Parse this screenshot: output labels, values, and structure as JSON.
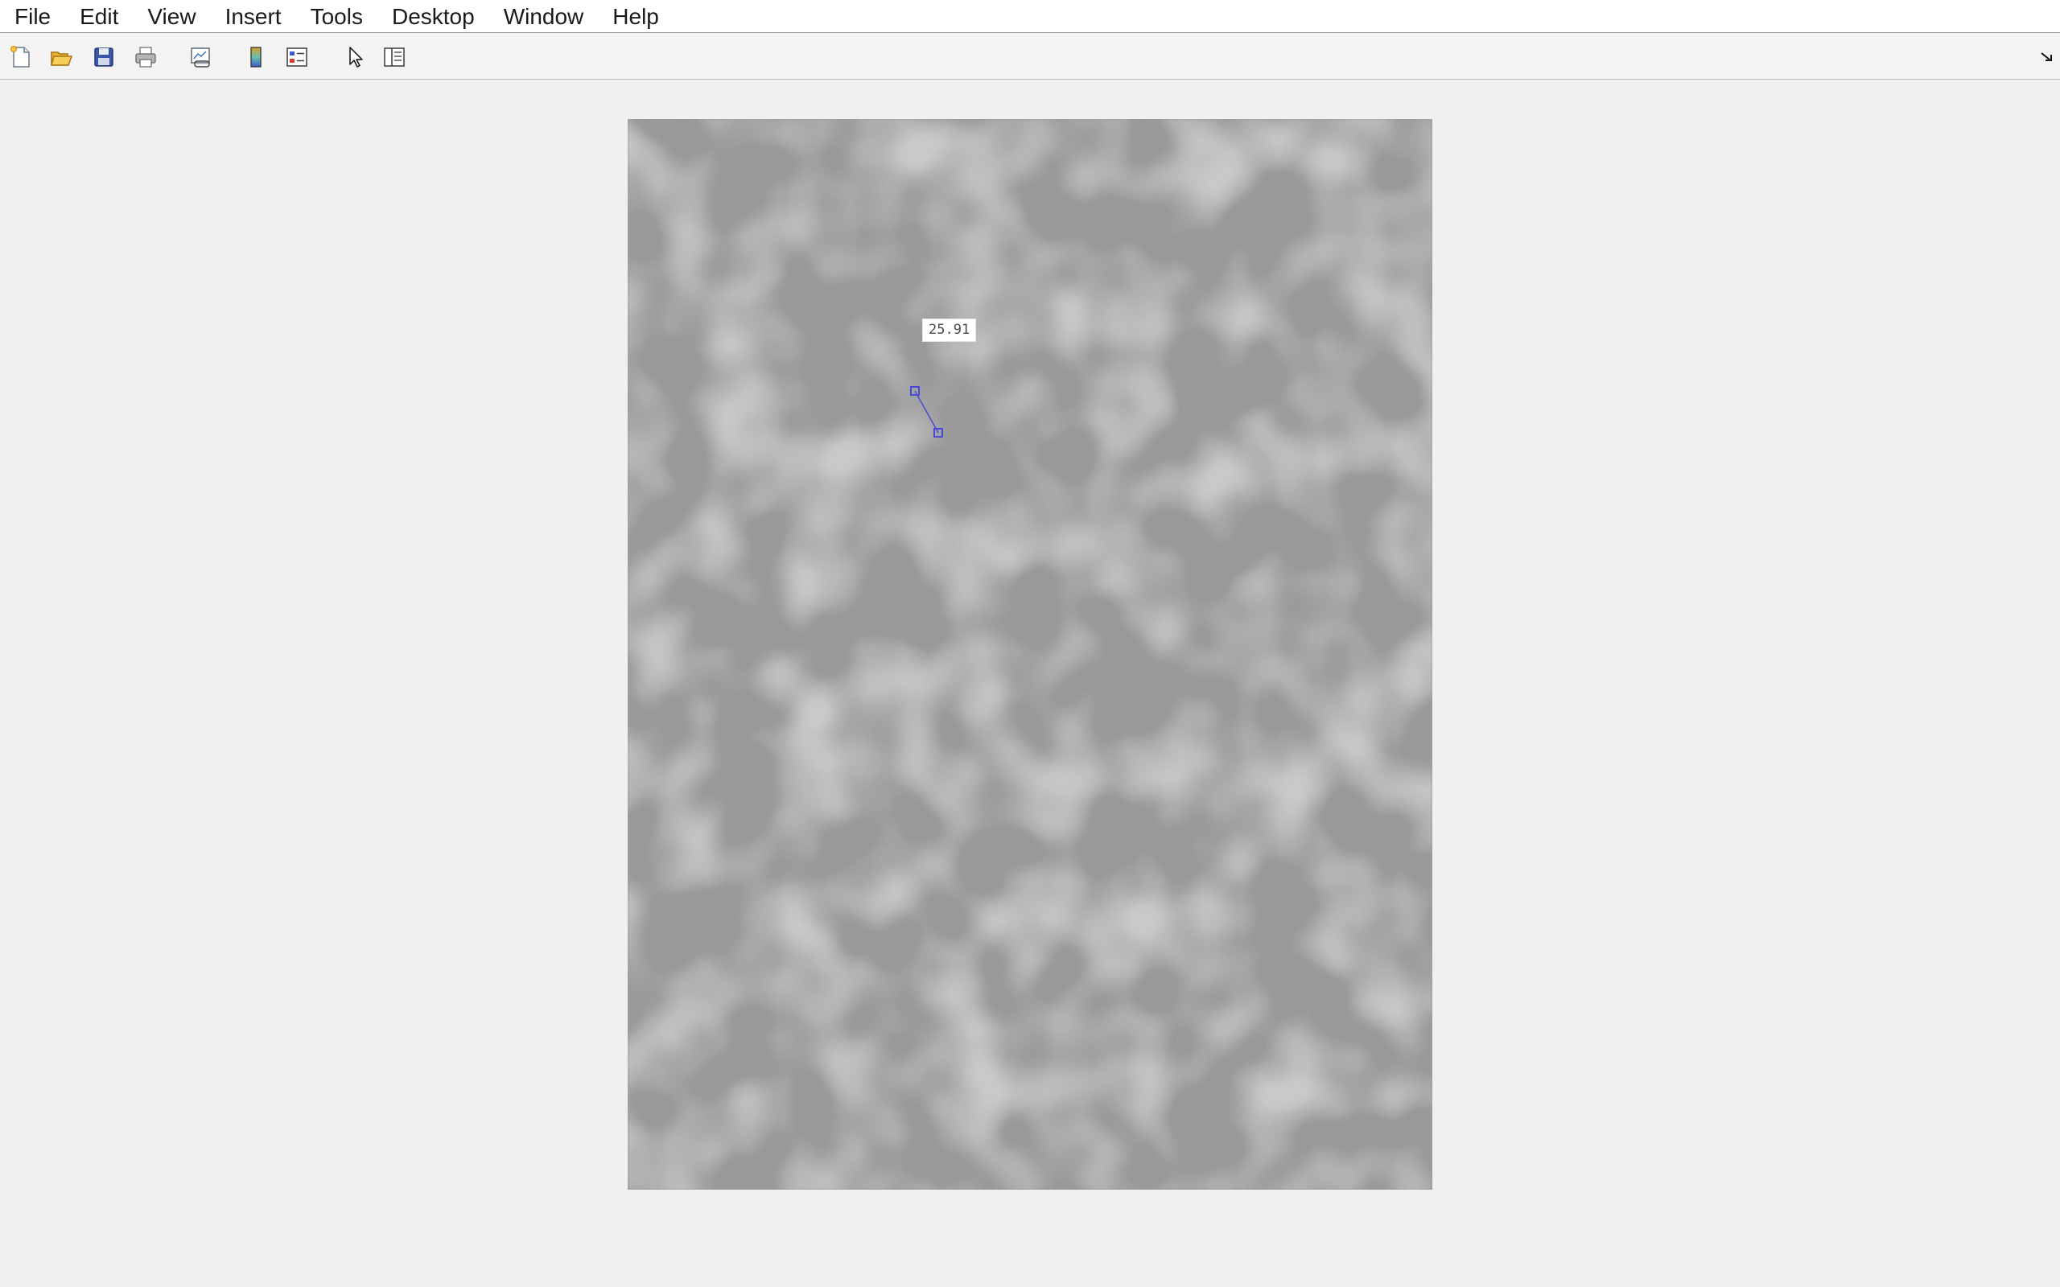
{
  "menubar": {
    "items": [
      {
        "label": "File"
      },
      {
        "label": "Edit"
      },
      {
        "label": "View"
      },
      {
        "label": "Insert"
      },
      {
        "label": "Tools"
      },
      {
        "label": "Desktop"
      },
      {
        "label": "Window"
      },
      {
        "label": "Help"
      }
    ]
  },
  "toolbar": {
    "buttons": [
      {
        "icon": "new-figure-icon"
      },
      {
        "icon": "open-file-icon"
      },
      {
        "icon": "save-icon"
      },
      {
        "icon": "print-icon"
      },
      {
        "icon": "link-plot-icon"
      },
      {
        "icon": "insert-colorbar-icon"
      },
      {
        "icon": "insert-legend-icon"
      },
      {
        "icon": "edit-plot-pointer-icon"
      },
      {
        "icon": "property-inspector-icon"
      }
    ],
    "dock_icon": "dock-arrow-icon"
  },
  "figure": {
    "measurement": {
      "distance_label": "25.91",
      "line_color": "#4a4ad8"
    }
  },
  "colors": {
    "menubar_bg": "#ffffff",
    "toolbar_bg": "#f3f3f3",
    "figure_bg": "#f0f0f0"
  }
}
